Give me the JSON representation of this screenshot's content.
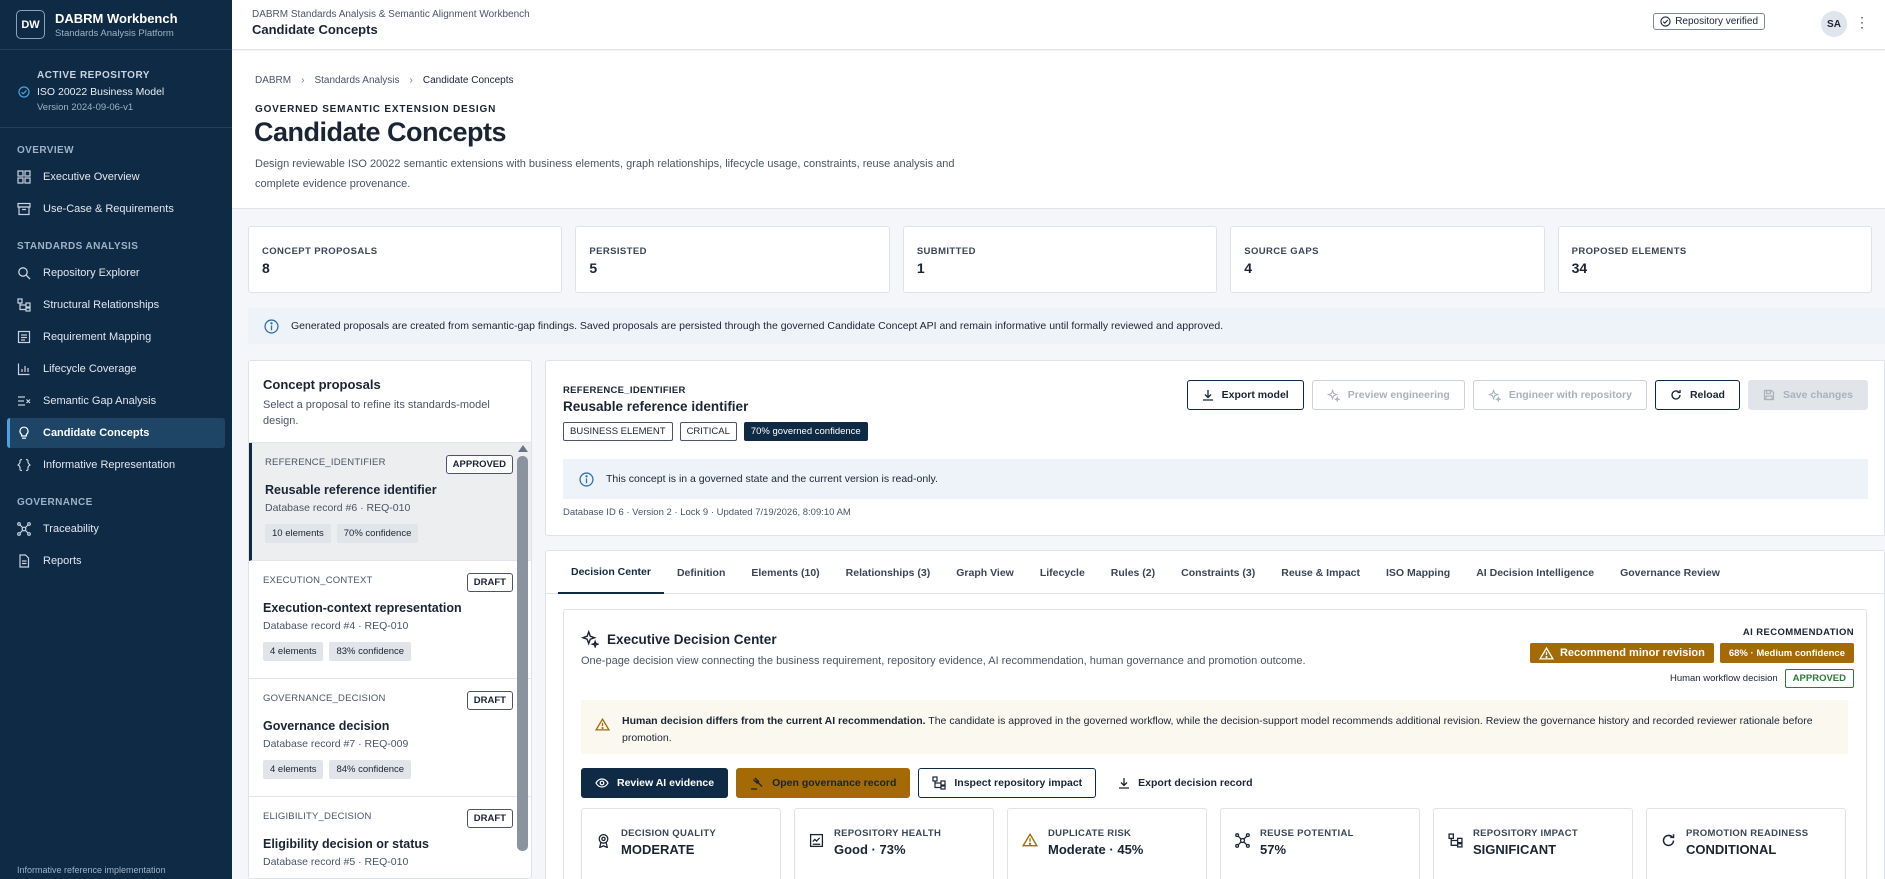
{
  "sidebar": {
    "logo": "DW",
    "title": "DABRM Workbench",
    "subtitle": "Standards Analysis Platform",
    "repo_label": "ACTIVE REPOSITORY",
    "repo_name": "ISO 20022 Business Model",
    "repo_version": "Version 2024-09-06-v1",
    "sections": {
      "overview": "OVERVIEW",
      "standards": "STANDARDS ANALYSIS",
      "governance": "GOVERNANCE"
    },
    "items": {
      "executive": "Executive Overview",
      "usecase": "Use-Case & Requirements",
      "repo_explorer": "Repository Explorer",
      "structural": "Structural Relationships",
      "req_mapping": "Requirement Mapping",
      "lifecycle": "Lifecycle Coverage",
      "gap": "Semantic Gap Analysis",
      "candidate": "Candidate Concepts",
      "informative": "Informative Representation",
      "traceability": "Traceability",
      "reports": "Reports"
    },
    "footer": "Informative reference implementation"
  },
  "topbar": {
    "supertitle": "DABRM Standards Analysis & Semantic Alignment Workbench",
    "title": "Candidate Concepts",
    "verified": "Repository verified",
    "avatar": "SA"
  },
  "header": {
    "crumbs": [
      "DABRM",
      "Standards Analysis",
      "Candidate Concepts"
    ],
    "eyebrow": "GOVERNED SEMANTIC EXTENSION DESIGN",
    "title": "Candidate Concepts",
    "desc": "Design reviewable ISO 20022 semantic extensions with business elements, graph relationships, lifecycle usage, constraints, reuse analysis and complete evidence provenance."
  },
  "stats": [
    {
      "label": "CONCEPT PROPOSALS",
      "value": "8"
    },
    {
      "label": "PERSISTED",
      "value": "5"
    },
    {
      "label": "SUBMITTED",
      "value": "1"
    },
    {
      "label": "SOURCE GAPS",
      "value": "4"
    },
    {
      "label": "PROPOSED ELEMENTS",
      "value": "34"
    }
  ],
  "info_banner": "Generated proposals are created from semantic-gap findings. Saved proposals are persisted through the governed Candidate Concept API and remain informative until formally reviewed and approved.",
  "proposals_panel": {
    "title": "Concept proposals",
    "subtitle": "Select a proposal to refine its standards-model design.",
    "items": [
      {
        "key": "REFERENCE_IDENTIFIER",
        "status": "APPROVED",
        "title": "Reusable reference identifier",
        "sub": "Database record #6 · REQ-010",
        "chips": [
          "10 elements",
          "70% confidence"
        ]
      },
      {
        "key": "EXECUTION_CONTEXT",
        "status": "DRAFT",
        "title": "Execution-context representation",
        "sub": "Database record #4 · REQ-010",
        "chips": [
          "4 elements",
          "83% confidence"
        ]
      },
      {
        "key": "GOVERNANCE_DECISION",
        "status": "DRAFT",
        "title": "Governance decision",
        "sub": "Database record #7 · REQ-009",
        "chips": [
          "4 elements",
          "84% confidence"
        ]
      },
      {
        "key": "ELIGIBILITY_DECISION",
        "status": "DRAFT",
        "title": "Eligibility decision or status",
        "sub": "Database record #5 · REQ-010",
        "chips": [
          "",
          ""
        ]
      }
    ]
  },
  "detail": {
    "key": "REFERENCE_IDENTIFIER",
    "title": "Reusable reference identifier",
    "badges": [
      "BUSINESS ELEMENT",
      "CRITICAL",
      "70% governed confidence"
    ],
    "actions": {
      "export": "Export model",
      "preview": "Preview engineering",
      "engineer": "Engineer with repository",
      "reload": "Reload",
      "save": "Save changes"
    },
    "readonly": "This concept is in a governed state and the current version is read-only.",
    "meta": "Database ID 6 · Version 2 · Lock 9 · Updated 7/19/2026, 8:09:10 AM"
  },
  "tabs": [
    "Decision Center",
    "Definition",
    "Elements (10)",
    "Relationships (3)",
    "Graph View",
    "Lifecycle",
    "Rules (2)",
    "Constraints (3)",
    "Reuse & Impact",
    "ISO Mapping",
    "AI Decision Intelligence",
    "Governance Review"
  ],
  "exec": {
    "title": "Executive Decision Center",
    "desc": "One-page decision view connecting the business requirement, repository evidence, AI recommendation, human governance and promotion outcome.",
    "ai_label": "AI RECOMMENDATION",
    "ai_rec": "Recommend minor revision",
    "ai_conf": "68% · Medium confidence",
    "hwd_label": "Human workflow decision",
    "hwd_value": "APPROVED",
    "warn_bold": "Human decision differs from the current AI recommendation.",
    "warn_text": " The candidate is approved in the governed workflow, while the decision-support model recommends additional revision. Review the governance history and recorded reviewer rationale before promotion.",
    "actions": {
      "review": "Review AI evidence",
      "open": "Open governance record",
      "inspect": "Inspect repository impact",
      "export": "Export decision record"
    },
    "metrics": [
      {
        "label": "DECISION QUALITY",
        "value": "MODERATE",
        "icon": "medal-icon"
      },
      {
        "label": "REPOSITORY HEALTH",
        "value": "Good · 73%",
        "icon": "health-icon"
      },
      {
        "label": "DUPLICATE RISK",
        "value": "Moderate · 45%",
        "icon": "warning-icon"
      },
      {
        "label": "REUSE POTENTIAL",
        "value": "57%",
        "icon": "network-icon"
      },
      {
        "label": "REPOSITORY IMPACT",
        "value": "SIGNIFICANT",
        "icon": "hierarchy-icon"
      },
      {
        "label": "PROMOTION READINESS",
        "value": "CONDITIONAL",
        "icon": "refresh-icon"
      }
    ]
  },
  "colors": {
    "sidebar": "#0f2a44",
    "accent": "#a46a05",
    "approved": "#2f7a3a"
  }
}
